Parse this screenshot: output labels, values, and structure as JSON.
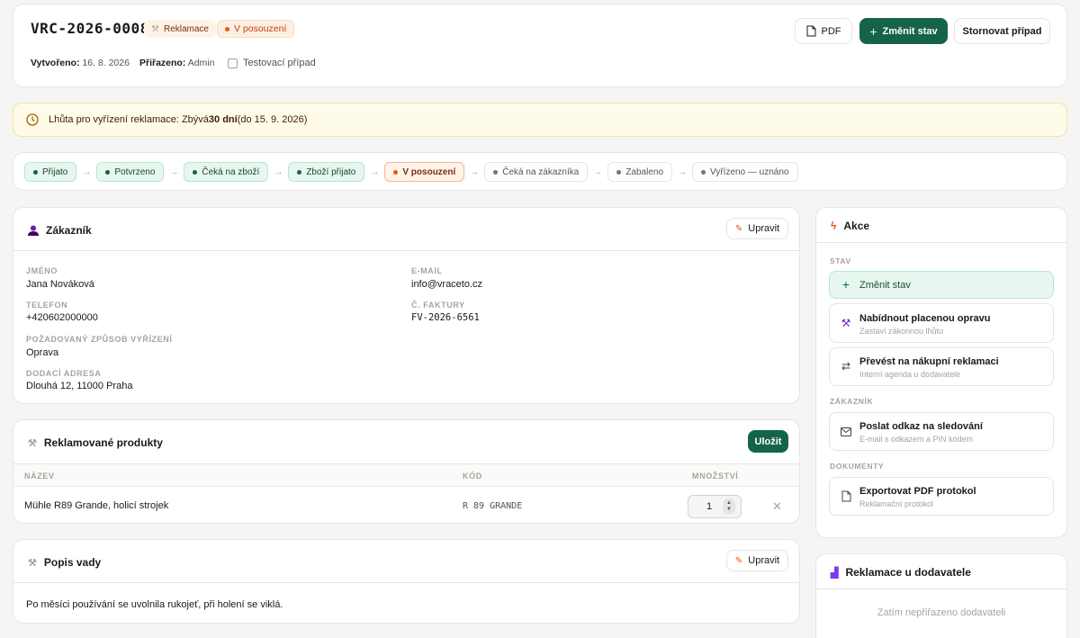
{
  "header": {
    "case_id": "VRC-2026-0008",
    "type_badge": "Reklamace",
    "status_badge": "V posouzení",
    "created_label": "Vytvořeno:",
    "created_value": "16. 8. 2026",
    "assigned_label": "Přiřazeno:",
    "assigned_value": "Admin",
    "test_case_label": "Testovací případ",
    "buttons": {
      "pdf": "PDF",
      "change_status": "Změnit stav",
      "cancel": "Stornovat případ"
    }
  },
  "deadline": {
    "prefix": "Lhůta pro vyřízení reklamace: Zbývá ",
    "days": "30 dní",
    "suffix": " (do 15. 9. 2026)"
  },
  "steps": [
    {
      "label": "Přijato",
      "state": "done"
    },
    {
      "label": "Potvrzeno",
      "state": "done"
    },
    {
      "label": "Čeká na zboží",
      "state": "done"
    },
    {
      "label": "Zboží přijato",
      "state": "done"
    },
    {
      "label": "V posouzení",
      "state": "current"
    },
    {
      "label": "Čeká na zákazníka",
      "state": "todo"
    },
    {
      "label": "Zabaleno",
      "state": "todo"
    },
    {
      "label": "Vyřízeno — uznáno",
      "state": "todo"
    }
  ],
  "customer": {
    "title": "Zákazník",
    "edit": "Upravit",
    "name_label": "JMÉNO",
    "name": "Jana Nováková",
    "email_label": "E-MAIL",
    "email": "info@vraceto.cz",
    "phone_label": "TELEFON",
    "phone": "+420602000000",
    "invoice_label": "Č. FAKTURY",
    "invoice": "FV-2026-6561",
    "resolution_label": "POŽADOVANÝ ZPŮSOB VYŘÍZENÍ",
    "resolution": "Oprava",
    "address_label": "DODACÍ ADRESA",
    "address": "Dlouhá 12, 11000 Praha"
  },
  "products": {
    "title": "Reklamované produkty",
    "save": "Uložit",
    "col_name": "NÁZEV",
    "col_code": "KÓD",
    "col_qty": "MNOŽSTVÍ",
    "rows": [
      {
        "name": "Mühle R89 Grande, holicí strojek",
        "code": "R 89 GRANDE",
        "qty": "1"
      }
    ]
  },
  "defect": {
    "title": "Popis vady",
    "edit": "Upravit",
    "text": "Po měsíci používání se uvolnila rukojeť, při holení se viklá."
  },
  "actions": {
    "title": "Akce",
    "sec_status": "STAV",
    "change_status": "Změnit stav",
    "paid_repair": "Nabídnout placenou opravu",
    "paid_repair_sub": "Zastaví zákonnou lhůtu",
    "convert": "Převést na nákupní reklamaci",
    "convert_sub": "Interní agenda u dodavatele",
    "sec_customer": "ZÁKAZNÍK",
    "send_link": "Poslat odkaz na sledování",
    "send_link_sub": "E-mail s odkazem a PIN kódem",
    "sec_docs": "DOKUMENTY",
    "export_pdf": "Exportovat PDF protokol",
    "export_pdf_sub": "Reklamační protokol"
  },
  "supplier": {
    "title": "Reklamace u dodavatele",
    "empty": "Zatím nepřiřazeno dodavateli"
  },
  "colors": {
    "primary": "#166448",
    "accent_orange": "#ea580c",
    "warning_bg": "#fefce8"
  }
}
